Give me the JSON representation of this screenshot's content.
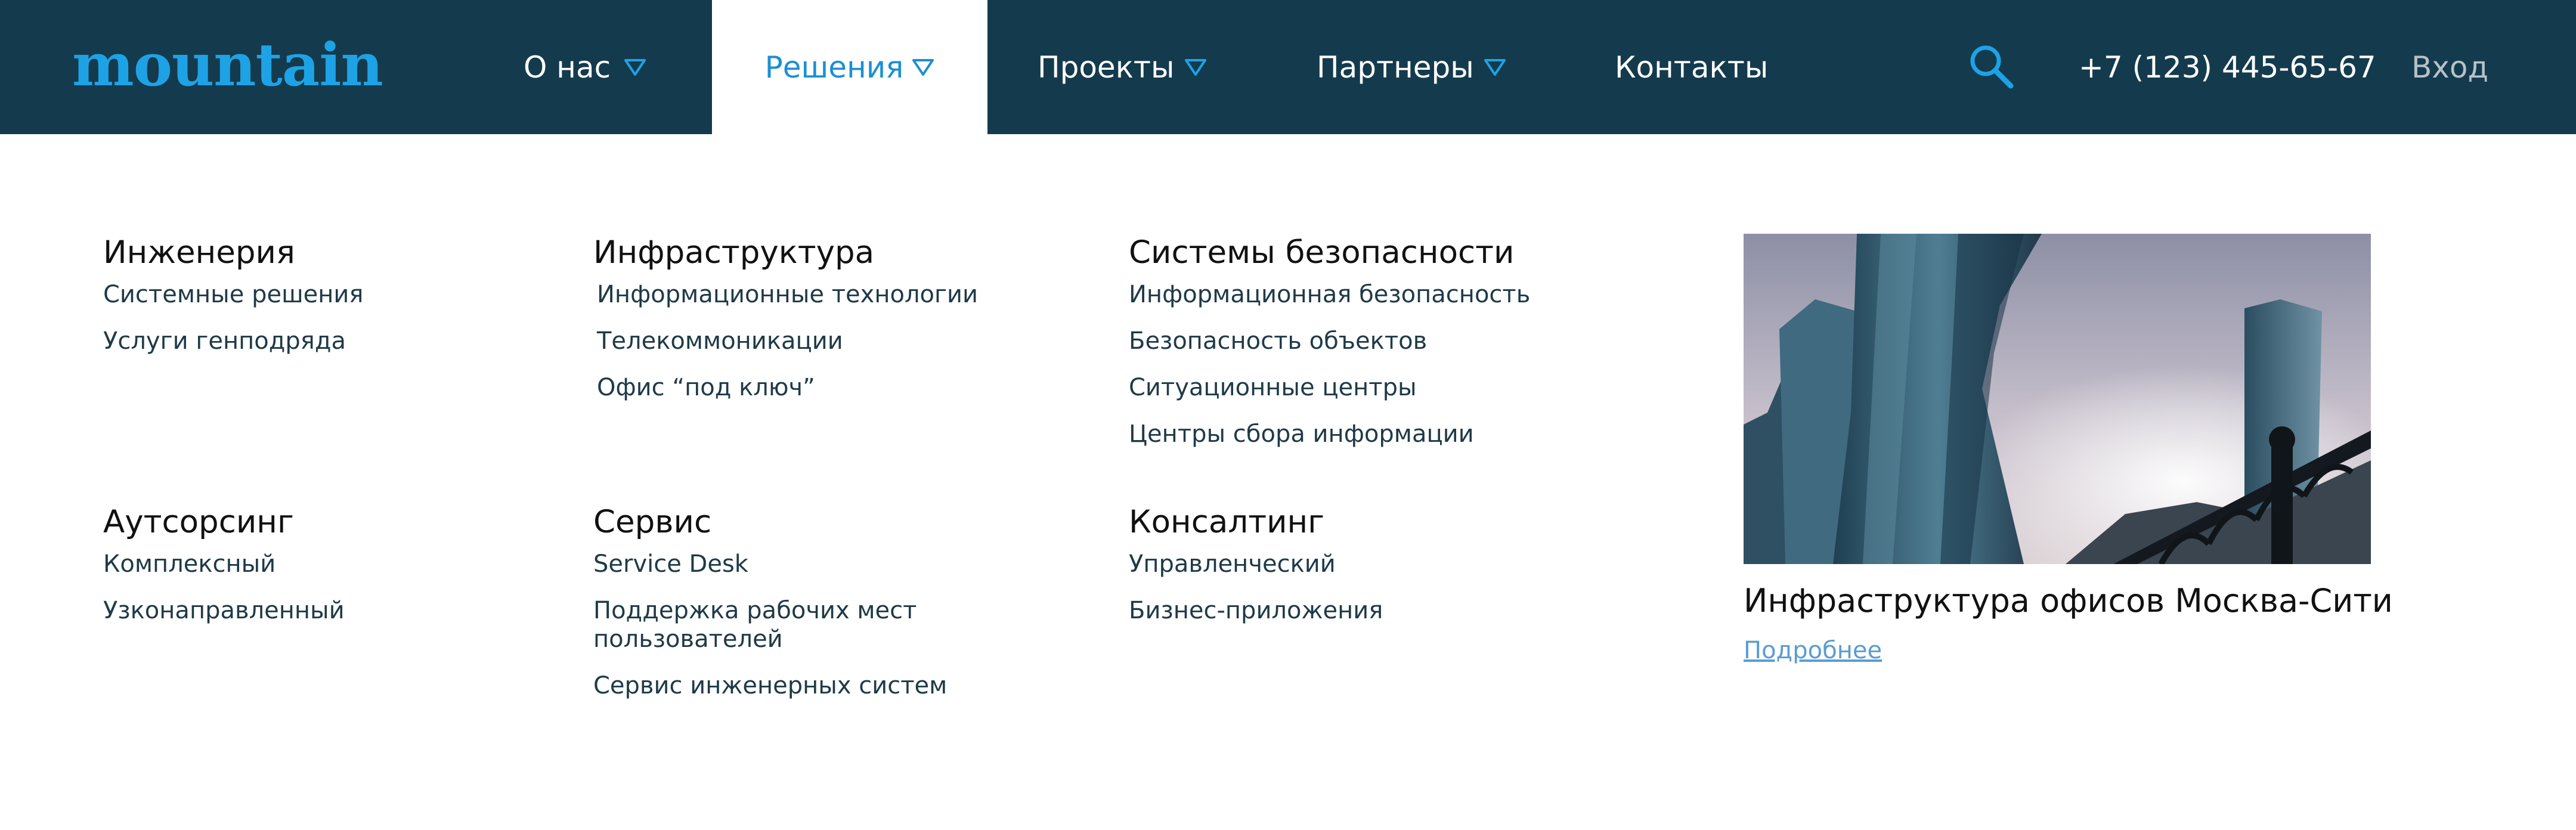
{
  "header": {
    "logo": "mountain",
    "nav": [
      {
        "label": "О нас",
        "has_dropdown": true,
        "active": false
      },
      {
        "label": "Решения",
        "has_dropdown": true,
        "active": true
      },
      {
        "label": "Проекты",
        "has_dropdown": true,
        "active": false
      },
      {
        "label": "Партнеры",
        "has_dropdown": true,
        "active": false
      },
      {
        "label": "Контакты",
        "has_dropdown": false,
        "active": false
      }
    ],
    "search_icon": "search-icon",
    "phone": "+7 (123) 445-65-67",
    "login": "Вход"
  },
  "menu": {
    "groups": [
      {
        "title": "Инженерия",
        "links": [
          "Системные решения",
          "Услуги генподряда"
        ]
      },
      {
        "title": "Инфраструктура",
        "links": [
          "Информационные технологии",
          "Телекоммоникации",
          "Офис “под ключ”"
        ]
      },
      {
        "title": "Системы безопасности",
        "links": [
          "Информационная безопасность",
          "Безопасность объектов",
          "Ситуационные центры",
          "Центры сбора информации"
        ]
      },
      {
        "title": "Аутсорсинг",
        "links": [
          "Комплексный",
          "Узконаправленный"
        ]
      },
      {
        "title": "Сервис",
        "links": [
          "Service Desk",
          "Поддержка рабочих мест пользователей",
          "Сервис инженерных систем"
        ]
      },
      {
        "title": "Консалтинг",
        "links": [
          "Управленческий",
          "Бизнес-приложения"
        ]
      }
    ]
  },
  "promo": {
    "title": "Инфраструктура офисов Москва-Сити",
    "link": "Подробнее"
  },
  "colors": {
    "header_bg": "#143b4d",
    "accent": "#1ea2e6",
    "active_nav_text": "#1b8fd2",
    "link_muted": "#5a9dd0"
  }
}
